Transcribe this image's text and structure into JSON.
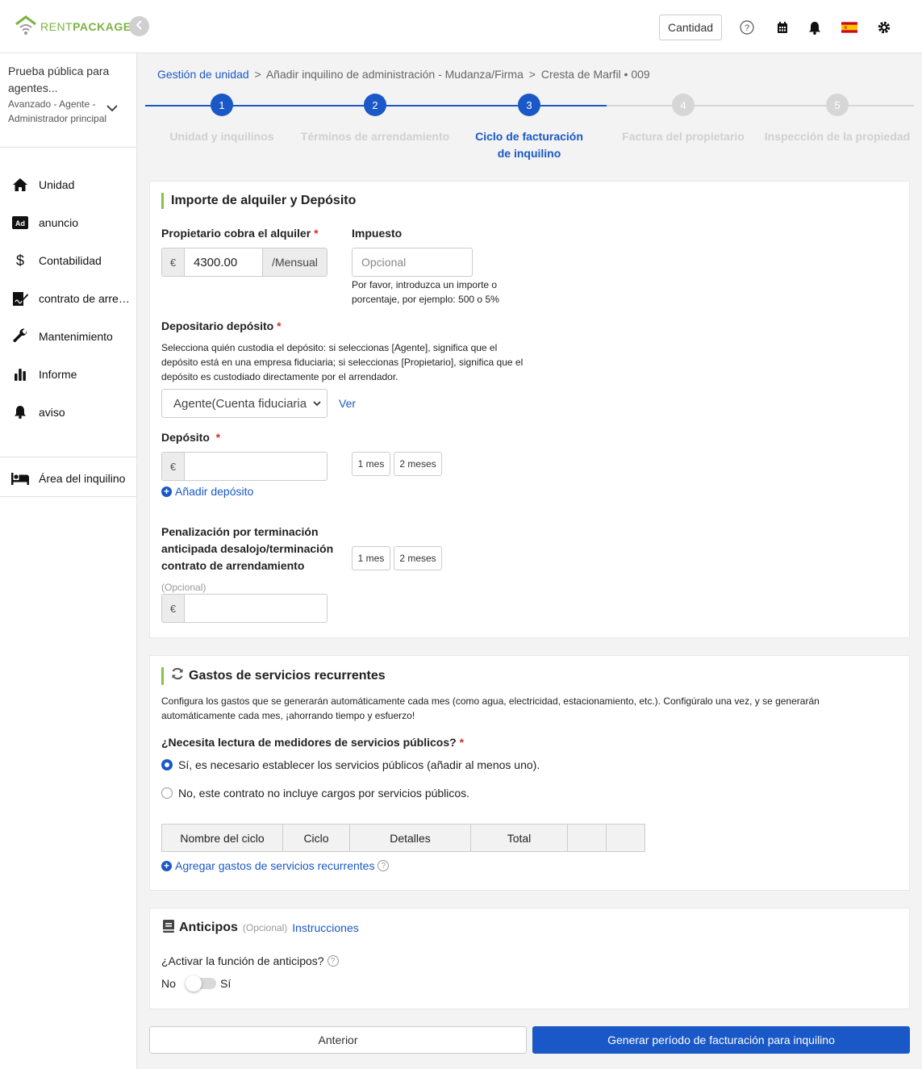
{
  "header": {
    "logo_part1": "RENT",
    "logo_part2": "PACKAGE",
    "cantidad_label": "Cantidad",
    "icons": [
      "help-icon",
      "calendar-icon",
      "bell-icon",
      "spain-flag-icon",
      "gear-icon"
    ]
  },
  "sidebar": {
    "org_name": "Prueba pública para agentes...",
    "org_role": "Avanzado - Agente - Administrador principal",
    "items": [
      {
        "label": "Unidad",
        "icon": "home-icon"
      },
      {
        "label": "anuncio",
        "icon": "ad-icon"
      },
      {
        "label": "Contabilidad",
        "icon": "dollar-icon"
      },
      {
        "label": "contrato de arrendamiento",
        "icon": "contract-icon"
      },
      {
        "label": "Mantenimiento",
        "icon": "wrench-icon"
      },
      {
        "label": "Informe",
        "icon": "chart-icon"
      },
      {
        "label": "aviso",
        "icon": "bell-icon"
      }
    ],
    "tenant_area": "Área del inquilino"
  },
  "breadcrumb": {
    "root": "Gestión de unidad",
    "sep": ">",
    "middle": "Añadir inquilino de administración - Mudanza/Firma",
    "last": "Cresta de Marfil • 009"
  },
  "steps": [
    {
      "num": "1",
      "label": "Unidad y inquilinos"
    },
    {
      "num": "2",
      "label": "Términos de arrendamiento"
    },
    {
      "num": "3",
      "label": "Ciclo de facturación de inquilino"
    },
    {
      "num": "4",
      "label": "Factura del propietario"
    },
    {
      "num": "5",
      "label": "Inspección de la propiedad"
    }
  ],
  "rent_card": {
    "title": "Importe de alquiler y Depósito",
    "owner_rent_label": "Propietario cobra el alquiler",
    "currency": "€",
    "rent_value": "4300.00",
    "rent_suffix": "/Mensual",
    "tax_label": "Impuesto",
    "tax_placeholder": "Opcional",
    "tax_hint": "Por favor, introduzca un importe o porcentaje, por ejemplo: 500 o 5%",
    "depositary_label": "Depositario depósito",
    "depositary_hint": "Selecciona quién custodia el depósito: si seleccionas [Agente], significa que el depósito está en una empresa fiduciaria; si seleccionas [Propietario], significa que el depósito es custodiado directamente por el arrendador.",
    "depositary_value": "Agente(Cuenta fiduciaria",
    "view_link": "Ver",
    "deposit_label": "Depósito",
    "one_month": "1 mes",
    "two_months": "2 meses",
    "add_deposit": "Añadir depósito",
    "penalty_label": "Penalización por terminación anticipada desalojo/terminación contrato de arrendamiento",
    "optional": "(Opcional)"
  },
  "utility_card": {
    "title": "Gastos de servicios recurrentes",
    "description": "Configura los gastos que se generarán automáticamente cada mes (como agua, electricidad, estacionamiento, etc.). Configúralo una vez, y se generarán automáticamente cada mes, ¡ahorrando tiempo y esfuerzo!",
    "question": "¿Necesita lectura de medidores de servicios públicos?",
    "option_yes": "Sí, es necesario establecer los servicios públicos (añadir al menos uno).",
    "option_no": "No, este contrato no incluye cargos por servicios públicos.",
    "selected": "yes",
    "table_headers": [
      "Nombre del ciclo",
      "Ciclo",
      "Detalles",
      "Total",
      "",
      ""
    ],
    "add_link": "Agregar gastos de servicios recurrentes"
  },
  "advance_card": {
    "title": "Anticipos",
    "optional": "(Opcional)",
    "instructions": "Instrucciones",
    "question": "¿Activar la función de anticipos?",
    "no": "No",
    "yes": "Sí",
    "enabled": false
  },
  "footer": {
    "previous": "Anterior",
    "generate": "Generar período de facturación para inquilino"
  },
  "colors": {
    "primary": "#1a58c7",
    "brand_green": "#7cb342",
    "required": "#d32f2f"
  }
}
